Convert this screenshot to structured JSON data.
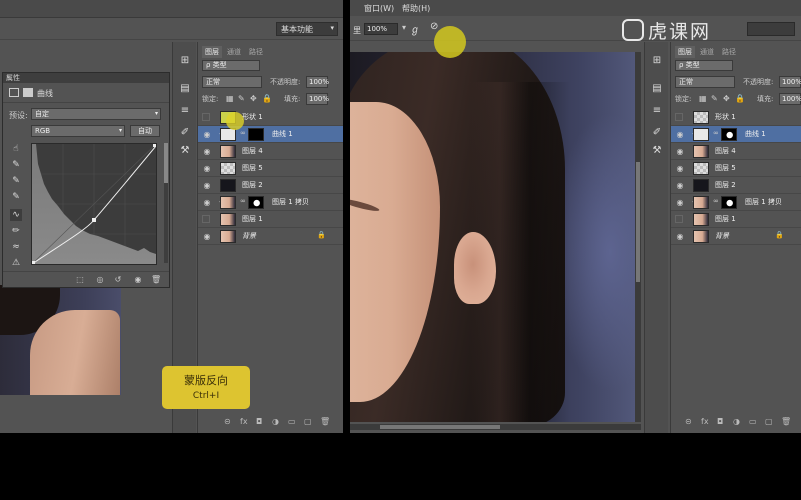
{
  "left": {
    "workspace": "基本功能",
    "properties": {
      "title": "属性",
      "header_label": "曲线",
      "preset_label": "预设:",
      "preset_value": "自定",
      "channel_value": "RGB",
      "auto_label": "自动"
    },
    "layers": {
      "tabs": [
        "图层",
        "通道",
        "路径"
      ],
      "kind": "ρ 类型",
      "blend": "正常",
      "opacity_label": "不透明度:",
      "opacity_value": "100%",
      "lock_label": "锁定:",
      "fill_label": "填充:",
      "fill_value": "100%",
      "items": [
        {
          "name": "形状 1",
          "visible": false,
          "thumb": "shape",
          "selected": false
        },
        {
          "name": "曲线 1",
          "visible": true,
          "thumb": "curve",
          "mask": "blackmask",
          "selected": true
        },
        {
          "name": "图层 4",
          "visible": true,
          "thumb": "face",
          "selected": false
        },
        {
          "name": "图层 5",
          "visible": true,
          "thumb": "check",
          "selected": false
        },
        {
          "name": "图层 2",
          "visible": true,
          "thumb": "dark",
          "selected": false
        },
        {
          "name": "图层 1 拷贝",
          "visible": true,
          "thumb": "face",
          "mask": "mask",
          "selected": false
        },
        {
          "name": "图层 1",
          "visible": false,
          "thumb": "face",
          "selected": false
        },
        {
          "name": "背景",
          "visible": true,
          "thumb": "face",
          "selected": false,
          "italic": true,
          "locked": true
        }
      ]
    },
    "tooltip": {
      "title": "蒙版反向",
      "keys": "Ctrl+I"
    }
  },
  "right": {
    "menu": [
      "窗口(W)",
      "帮助(H)"
    ],
    "zoom": "100%",
    "logo": "虎课网",
    "layers": {
      "tabs": [
        "图层",
        "通道",
        "路径"
      ],
      "kind": "ρ 类型",
      "blend": "正常",
      "opacity_label": "不透明度:",
      "opacity_value": "100%",
      "lock_label": "锁定:",
      "fill_label": "填充:",
      "fill_value": "100%",
      "items": [
        {
          "name": "形状 1",
          "visible": false,
          "thumb": "check",
          "selected": false
        },
        {
          "name": "曲线 1",
          "visible": true,
          "thumb": "curve",
          "mask": "mask",
          "selected": true
        },
        {
          "name": "图层 4",
          "visible": true,
          "thumb": "face",
          "selected": false
        },
        {
          "name": "图层 5",
          "visible": true,
          "thumb": "check",
          "selected": false
        },
        {
          "name": "图层 2",
          "visible": true,
          "thumb": "dark",
          "selected": false
        },
        {
          "name": "图层 1 拷贝",
          "visible": true,
          "thumb": "face",
          "mask": "mask",
          "selected": false
        },
        {
          "name": "图层 1",
          "visible": false,
          "thumb": "face",
          "selected": false
        },
        {
          "name": "背景",
          "visible": true,
          "thumb": "face",
          "selected": false,
          "italic": true,
          "locked": true
        }
      ]
    }
  },
  "icons": [
    "eye-icon",
    "lock-icon",
    "link-icon",
    "fx-icon",
    "mask-icon",
    "new-layer-icon",
    "trash-icon",
    "folder-icon"
  ],
  "colors": {
    "selection": "#4f6fa2",
    "tooltip": "#ddc430",
    "panel": "#535353"
  }
}
